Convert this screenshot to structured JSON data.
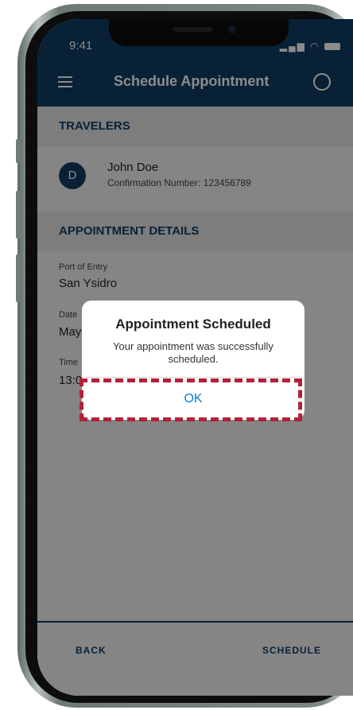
{
  "status_bar": {
    "time": "9:41",
    "signal": "signal-icon",
    "wifi": "wifi-icon",
    "battery": "battery-icon"
  },
  "header": {
    "title": "Schedule Appointment",
    "menu_icon": "menu-icon",
    "profile_icon": "profile-icon"
  },
  "travelers": {
    "heading": "TRAVELERS",
    "items": [
      {
        "initial": "D",
        "name": "John Doe",
        "confirmation": "Confirmation Number: 123456789"
      }
    ]
  },
  "appointment": {
    "heading": "APPOINTMENT DETAILS",
    "port_label": "Port of Entry",
    "port_value": "San Ysidro",
    "date_label": "Date",
    "date_value": "May",
    "time_label": "Time",
    "time_value": "13:0"
  },
  "footer": {
    "back_label": "BACK",
    "schedule_label": "SCHEDULE"
  },
  "dialog": {
    "title": "Appointment Scheduled",
    "message": "Your appointment was successfully scheduled.",
    "ok_label": "OK"
  },
  "colors": {
    "brand": "#0f3c63",
    "link": "#0a7bdc",
    "highlight": "#b3203b"
  }
}
